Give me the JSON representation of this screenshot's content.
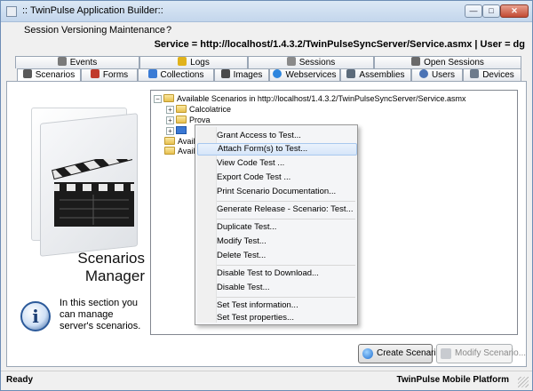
{
  "window": {
    "title": ":: TwinPulse Application Builder::",
    "controls": {
      "minimize": "—",
      "maximize": "□",
      "close": "✕"
    }
  },
  "menu": [
    "Session",
    "Versioning",
    "Maintenance",
    "?"
  ],
  "service_bar": {
    "text": "Service = http://localhost/1.4.3.2/TwinPulseSyncServer/Service.asmx | User = dg"
  },
  "tabs": {
    "row1": [
      {
        "label": "Events",
        "icon": "events-icon",
        "color": "#7a7a7a"
      },
      {
        "label": "Logs",
        "icon": "logs-icon",
        "color": "#e0b21b"
      },
      {
        "label": "Sessions",
        "icon": "sessions-icon",
        "color": "#8a8a8a"
      },
      {
        "label": "Open Sessions",
        "icon": "open-sessions-icon",
        "color": "#6a6a6a"
      }
    ],
    "row2": [
      {
        "label": "Scenarios",
        "icon": "scenarios-icon",
        "color": "#5a5a5a"
      },
      {
        "label": "Forms",
        "icon": "forms-icon",
        "color": "#c0392b"
      },
      {
        "label": "Collections",
        "icon": "collections-icon",
        "color": "#3a7bd5"
      },
      {
        "label": "Images",
        "icon": "images-icon",
        "color": "#4a4a4a"
      },
      {
        "label": "Webservices",
        "icon": "webservices-icon",
        "color": "#2e86de"
      },
      {
        "label": "Assemblies",
        "icon": "assemblies-icon",
        "color": "#5c6b7a"
      },
      {
        "label": "Users",
        "icon": "users-icon",
        "color": "#4a73b5"
      },
      {
        "label": "Devices",
        "icon": "devices-icon",
        "color": "#6e7b8c"
      }
    ]
  },
  "left_panel": {
    "title_line1": "Scenarios",
    "title_line2": "Manager",
    "info": "In this section you can manage server's scenarios."
  },
  "tree": {
    "root": "Available Scenarios in http://localhost/1.4.3.2/TwinPulseSyncServer/Service.asmx",
    "children": [
      "Calcolatrice",
      "Prova"
    ],
    "partial": [
      "Avail",
      "Avail"
    ]
  },
  "context_menu": [
    {
      "label": "Grant Access to Test...",
      "highlighted": false
    },
    {
      "label": "Attach Form(s) to Test...",
      "highlighted": true
    },
    {
      "label": "View Code Test ...",
      "highlighted": false
    },
    {
      "label": "Export Code Test ...",
      "highlighted": false
    },
    {
      "label": "Print Scenario Documentation...",
      "highlighted": false
    },
    {
      "label": "Generate Release - Scenario: Test...",
      "highlighted": false
    },
    {
      "label": "Duplicate Test...",
      "highlighted": false
    },
    {
      "label": "Modify Test...",
      "highlighted": false
    },
    {
      "label": "Delete Test...",
      "highlighted": false
    },
    {
      "label": "Disable Test to Download...",
      "highlighted": false
    },
    {
      "label": "Disable Test...",
      "highlighted": false
    },
    {
      "label": "Set Test information...",
      "highlighted": false
    },
    {
      "label": "Set Test properties...",
      "highlighted": false
    }
  ],
  "buttons": {
    "create": "Create Scenario...",
    "modify": "Modify Scenario..."
  },
  "status": {
    "left": "Ready",
    "right": "TwinPulse Mobile Platform"
  }
}
